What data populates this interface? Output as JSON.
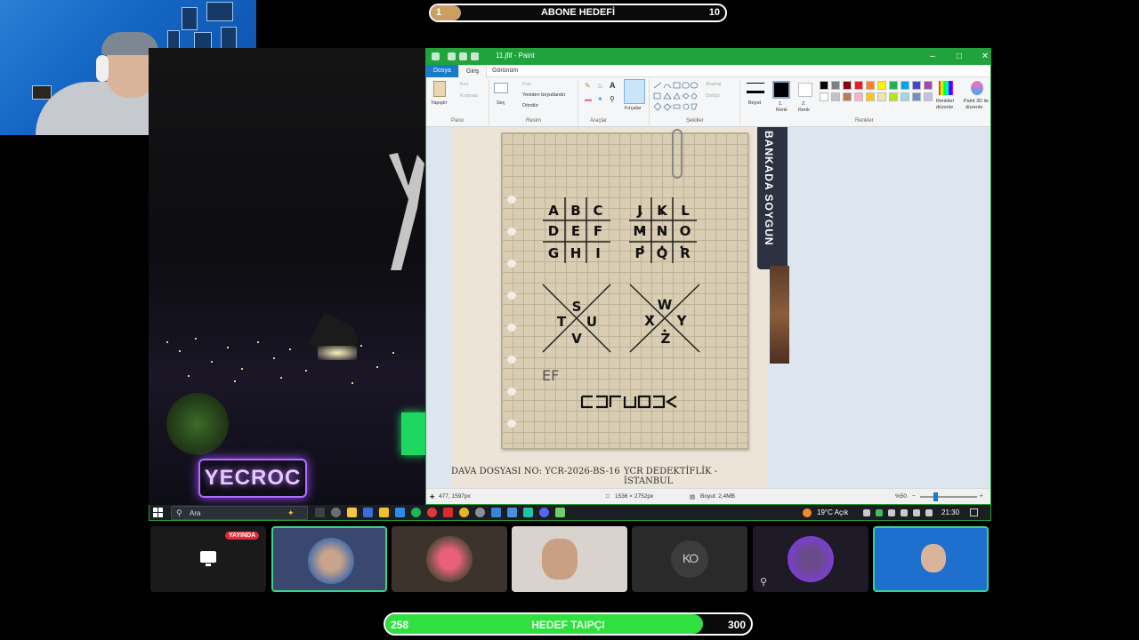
{
  "subscriber_goal": {
    "title": "ABONE HEDEFİ",
    "current": "1",
    "target": "10",
    "progress_fraction": 0.1
  },
  "backdrop": {
    "neon_sign": "YECROC"
  },
  "paint": {
    "window_title": "11.jfif - Paint",
    "tabs": [
      "Dosya",
      "Giriş",
      "Görünüm"
    ],
    "ribbon": {
      "pano_group": "Pano",
      "paste": "Yapıştır",
      "cut": "Kes",
      "copy": "Kopyala",
      "resim_group": "Resim",
      "select": "Seç",
      "crop": "Kırp",
      "resize": "Yeniden boyutlandır",
      "rotate": "Döndür",
      "araclar_group": "Araçlar",
      "brushes": "Fırçalar",
      "sekiller_group": "Şekiller",
      "outline": "Anahat",
      "fill": "Doldur",
      "size": "Boyut",
      "color1": "1.",
      "color1_sub": "Renk",
      "color2": "2.",
      "color2_sub": "Renk",
      "renkler_group": "Renkler",
      "edit_colors_1": "Renkleri",
      "edit_colors_2": "düzenle",
      "paint3d_1": "Paint 3D ile",
      "paint3d_2": "düzenle"
    },
    "palette": [
      "#000000",
      "#7f7f7f",
      "#880015",
      "#ed1c24",
      "#ff7f27",
      "#fff200",
      "#22b14c",
      "#00a2e8",
      "#3f48cc",
      "#a349a4",
      "#ffffff",
      "#c3c3c3",
      "#b97a57",
      "#ffaec9",
      "#ffc90e",
      "#efe4b0",
      "#b5e61d",
      "#99d9ea",
      "#7092be",
      "#c8bfe7"
    ],
    "document": {
      "grid1": [
        "A",
        "B",
        "C",
        "D",
        "E",
        "F",
        "G",
        "H",
        "I"
      ],
      "grid2": [
        "J",
        "K",
        "L",
        "M",
        "N",
        "O",
        "P",
        "Q",
        "R"
      ],
      "x1": [
        "S",
        "T",
        "U",
        "V"
      ],
      "x2": [
        "W",
        "X",
        "Y",
        "Z"
      ],
      "handwritten": "EF",
      "banner": "BANKADA SOYGUN",
      "case_no": "DAVA DOSYASI NO: YCR-2026-BS-16",
      "agency": "YCR DEDEKTİFLİK - İSTANBUL"
    },
    "status": {
      "cursor": "477, 1597px",
      "dimensions": "1536 × 2752px",
      "filesize": "Boyut: 2,4MB",
      "zoom": "%50"
    }
  },
  "taskbar": {
    "search_placeholder": "Ara",
    "weather": "19°C  Açık",
    "clock": "21:30"
  },
  "participants": {
    "live_badge": "YAYINDA",
    "ko_initials": "KO"
  },
  "donation_goal": {
    "title": "HEDEF TAIPÇI",
    "current": "258",
    "target": "300",
    "progress_fraction": 0.86
  }
}
